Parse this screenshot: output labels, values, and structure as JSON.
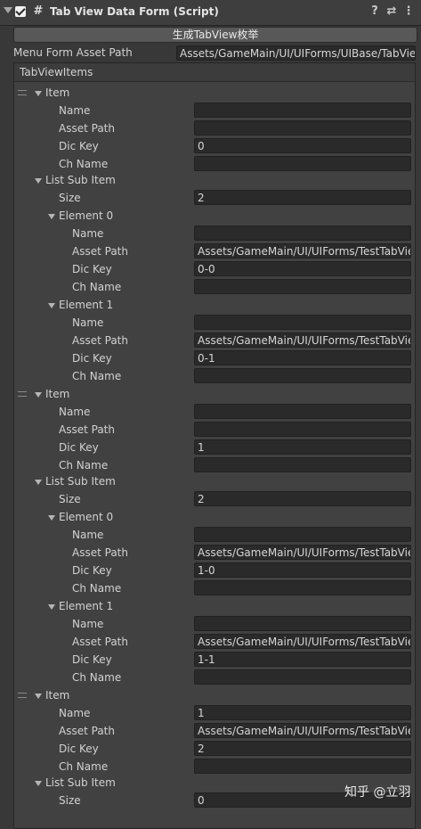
{
  "component": {
    "title": "Tab View Data Form (Script)",
    "icons": [
      "help-icon",
      "preset-icon",
      "more-vert-icon"
    ],
    "help_glyph": "?",
    "preset_glyph": "⇄",
    "more_glyph": "⋮",
    "script_glyph": "#"
  },
  "generate_button": {
    "label": "生成TabView枚举"
  },
  "menu_form": {
    "label": "Menu Form Asset Path",
    "value": "Assets/GameMain/UI/UIForms/UIBase/TabView"
  },
  "list": {
    "label": "TabViewItems"
  },
  "labels": {
    "item": "Item",
    "name": "Name",
    "asset_path": "Asset Path",
    "dic_key": "Dic Key",
    "ch_name": "Ch Name",
    "list_sub_item": "List Sub Item",
    "size": "Size",
    "element0": "Element 0",
    "element1": "Element 1"
  },
  "items": [
    {
      "name": "",
      "asset_path": "",
      "dic_key": "0",
      "ch_name": "",
      "size": "2",
      "elements": [
        {
          "name": "",
          "asset_path": "Assets/GameMain/UI/UIForms/TestTabView",
          "dic_key": "0-0",
          "ch_name": ""
        },
        {
          "name": "",
          "asset_path": "Assets/GameMain/UI/UIForms/TestTabView",
          "dic_key": "0-1",
          "ch_name": ""
        }
      ]
    },
    {
      "name": "",
      "asset_path": "",
      "dic_key": "1",
      "ch_name": "",
      "size": "2",
      "elements": [
        {
          "name": "",
          "asset_path": "Assets/GameMain/UI/UIForms/TestTabView",
          "dic_key": "1-0",
          "ch_name": ""
        },
        {
          "name": "",
          "asset_path": "Assets/GameMain/UI/UIForms/TestTabView",
          "dic_key": "1-1",
          "ch_name": ""
        }
      ]
    },
    {
      "name": "1",
      "asset_path": "Assets/GameMain/UI/UIForms/TestTabView",
      "dic_key": "2",
      "ch_name": "",
      "size": "0",
      "elements": []
    }
  ],
  "watermark": "知乎 @立羽"
}
